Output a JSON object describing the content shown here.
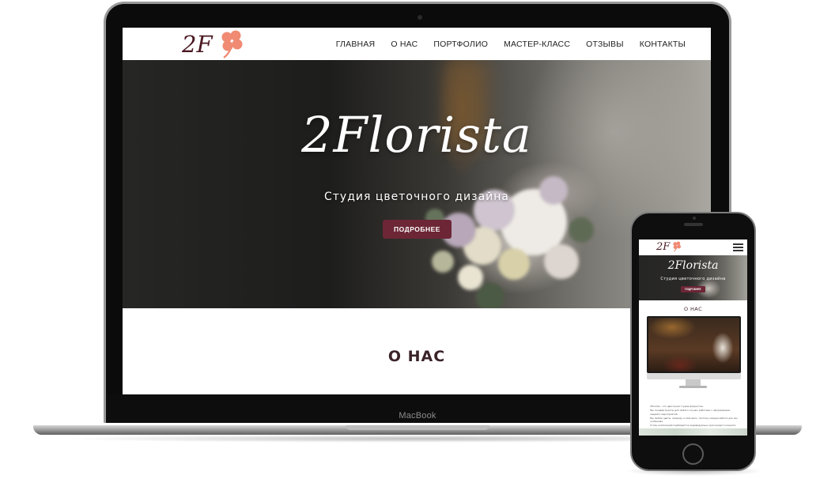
{
  "desktop": {
    "logo": {
      "text": "2F",
      "icon": "clover-icon"
    },
    "nav": [
      "ГЛАВНАЯ",
      "О НАС",
      "ПОРТФОЛИО",
      "МАСТЕР-КЛАСС",
      "ОТЗЫВЫ",
      "КОНТАКТЫ"
    ],
    "hero": {
      "title": "2Florista",
      "subtitle": "Студия цветочного дизайна",
      "button": "ПОДРОБНЕЕ"
    },
    "about_title": "О НАС"
  },
  "laptop_brand": "MacBook",
  "mobile": {
    "logo": {
      "text": "2F",
      "icon": "clover-icon"
    },
    "menu_icon": "hamburger-icon",
    "hero": {
      "title": "2Florista",
      "subtitle": "Студия цветочного дизайна",
      "button": "ПОДРОБНЕЕ"
    },
    "about_title": "О НАС",
    "about_text": [
      "2Florista – это цветочная студия флористов.",
      "Мы создаём букеты для любого случая, работаем с оформлением свадеб и мероприятий.",
      "Мы любим цветы, природу и своё дело, поэтому каждая работа для нас особенная.",
      "Стиль композиций подбирается индивидуально для каждого клиента.",
      "Студия флористики 2Florista – www.2florista.ru"
    ]
  },
  "colors": {
    "accent": "#6c2636",
    "logo_text": "#4a1822",
    "clover": "#f08a72"
  }
}
